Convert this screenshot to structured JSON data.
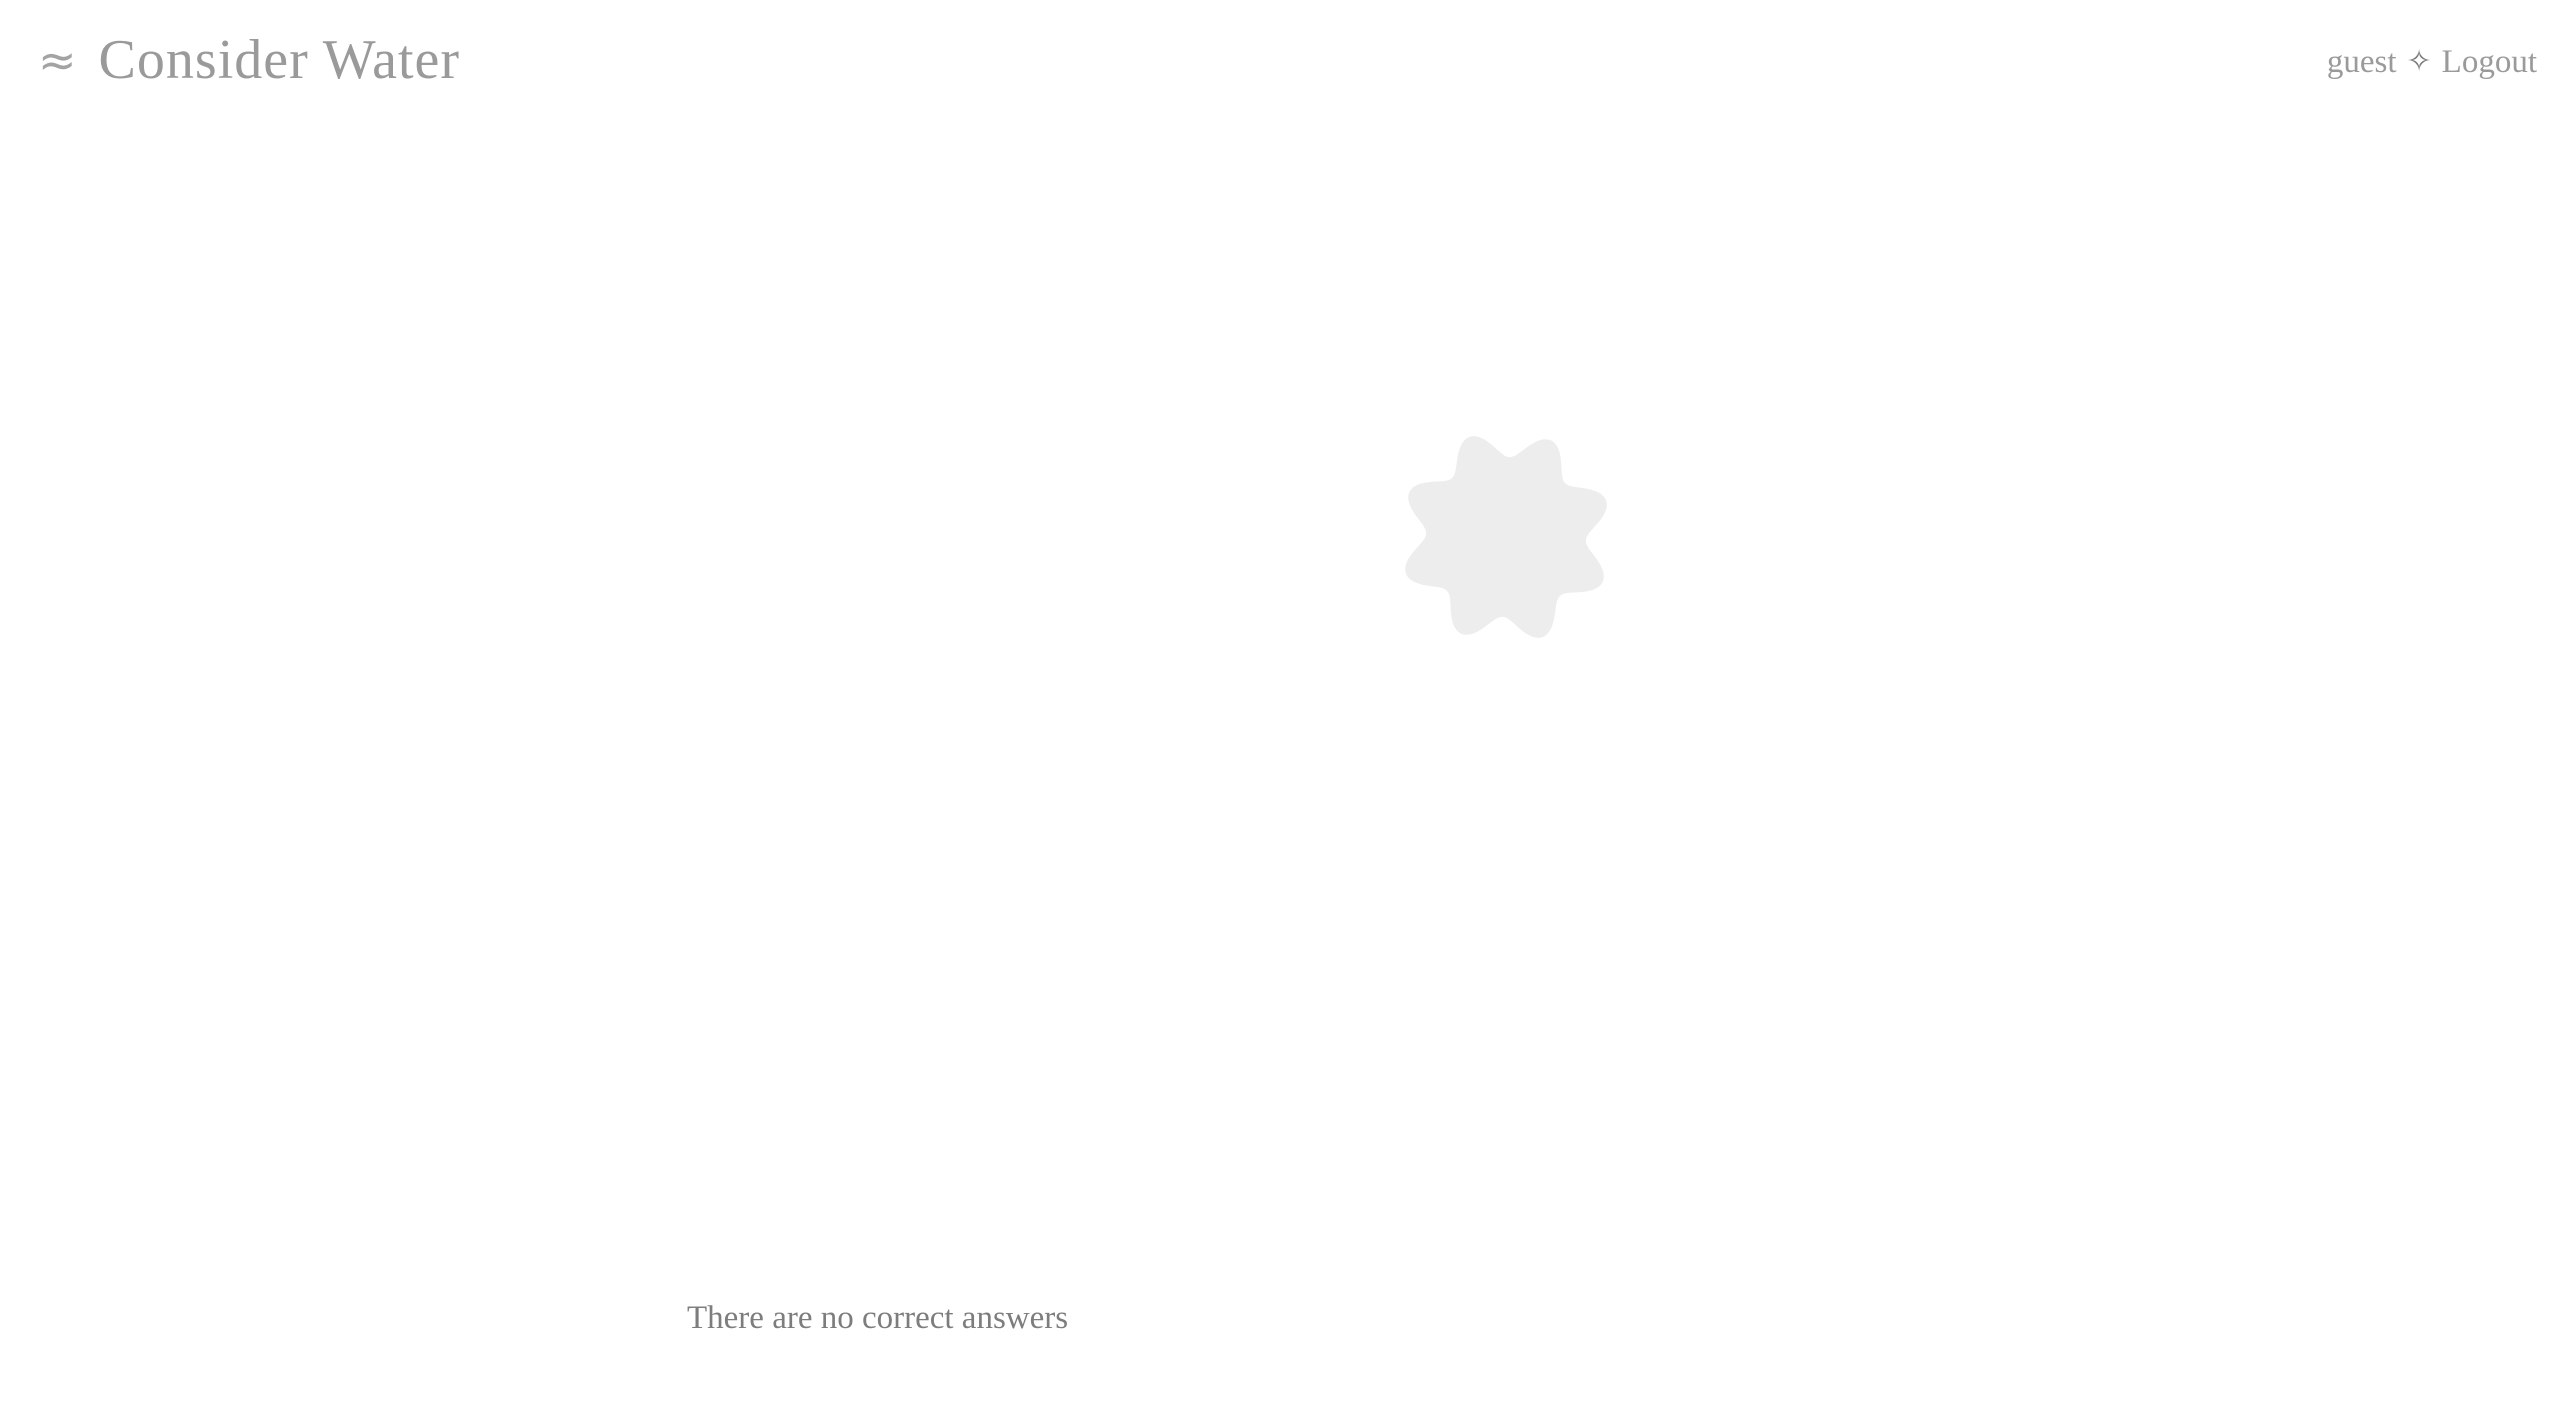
{
  "header": {
    "brand_icon": "≈",
    "brand_title": "Consider Water",
    "user": "guest",
    "separator": "✧",
    "logout_label": "Logout"
  },
  "spinner": {
    "icon": "scalloped-star-loading-icon",
    "color": "#ededed"
  },
  "main": {
    "message": "There are no correct answers"
  },
  "colors": {
    "text_muted": "#9a9a9a",
    "text_body": "#7d7d7d",
    "background": "#ffffff"
  }
}
